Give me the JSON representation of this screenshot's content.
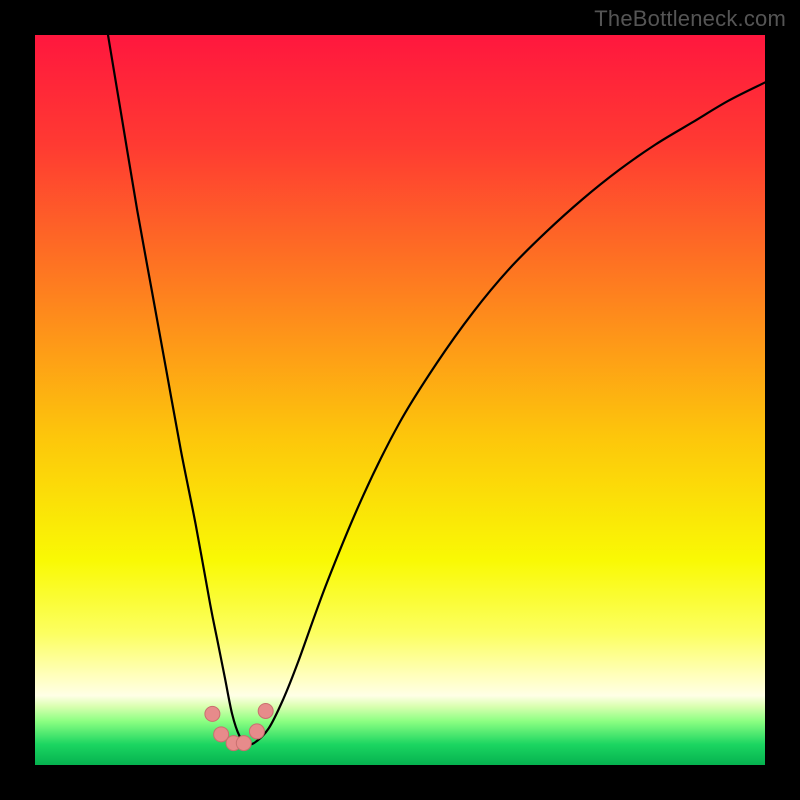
{
  "watermark": "TheBottleneck.com",
  "colors": {
    "frame": "#000000",
    "watermark_text": "#555555",
    "curve": "#000000",
    "marker_fill": "#e78b8b",
    "marker_stroke": "#c96f6f",
    "gradient_stops": [
      {
        "offset": 0.0,
        "color": "#ff173e"
      },
      {
        "offset": 0.15,
        "color": "#ff3a32"
      },
      {
        "offset": 0.35,
        "color": "#fe7f1f"
      },
      {
        "offset": 0.55,
        "color": "#fdc60b"
      },
      {
        "offset": 0.72,
        "color": "#f9f904"
      },
      {
        "offset": 0.82,
        "color": "#fcff61"
      },
      {
        "offset": 0.88,
        "color": "#ffffc0"
      },
      {
        "offset": 0.905,
        "color": "#ffffe6"
      },
      {
        "offset": 0.92,
        "color": "#d9ffb0"
      },
      {
        "offset": 0.94,
        "color": "#8cff82"
      },
      {
        "offset": 0.972,
        "color": "#1bd561"
      },
      {
        "offset": 1.0,
        "color": "#05b24f"
      }
    ]
  },
  "chart_data": {
    "type": "line",
    "title": "",
    "xlabel": "",
    "ylabel": "",
    "xlim": [
      0,
      100
    ],
    "ylim": [
      0,
      100
    ],
    "grid": false,
    "series": [
      {
        "name": "curve",
        "x": [
          10,
          12,
          14,
          16,
          18,
          20,
          22,
          24,
          25,
          26,
          27,
          28,
          29,
          30,
          32,
          34,
          36,
          40,
          45,
          50,
          55,
          60,
          65,
          70,
          75,
          80,
          85,
          90,
          95,
          100
        ],
        "y": [
          100,
          88,
          76,
          65,
          54,
          43,
          33,
          22,
          17,
          12,
          7,
          4,
          3,
          3,
          5,
          9,
          14,
          25,
          37,
          47,
          55,
          62,
          68,
          73,
          77.5,
          81.5,
          85,
          88,
          91,
          93.5
        ]
      }
    ],
    "markers": {
      "name": "valley-points",
      "x": [
        24.3,
        25.5,
        27.2,
        28.6,
        30.4,
        31.6
      ],
      "y": [
        7.0,
        4.2,
        3.0,
        3.0,
        4.6,
        7.4
      ]
    }
  }
}
